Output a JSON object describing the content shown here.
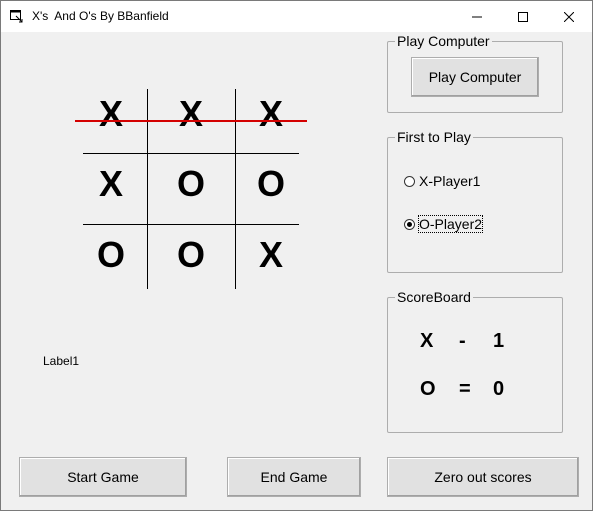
{
  "window": {
    "title": "X's  And O's By BBanfield",
    "icons": {
      "app": "app-icon",
      "minimize": "minimize-icon",
      "maximize": "maximize-icon",
      "close": "close-icon"
    }
  },
  "board": {
    "cells": [
      "X",
      "X",
      "X",
      "X",
      "O",
      "O",
      "O",
      "O",
      "X"
    ],
    "winning_line_color": "#d40000"
  },
  "play_computer": {
    "caption": "Play Computer",
    "button_label": "Play Computer"
  },
  "first_to_play": {
    "caption": "First to Play",
    "options": [
      {
        "label": "X-Player1",
        "selected": false
      },
      {
        "label": "O-Player2",
        "selected": true
      }
    ]
  },
  "scoreboard": {
    "caption": "ScoreBoard",
    "rows": [
      {
        "player": "X",
        "separator": "-",
        "score": "1"
      },
      {
        "player": "O",
        "separator": "=",
        "score": "0"
      }
    ]
  },
  "status_label": "Label1",
  "buttons": {
    "start": "Start Game",
    "end": "End Game",
    "zero": "Zero out scores"
  }
}
